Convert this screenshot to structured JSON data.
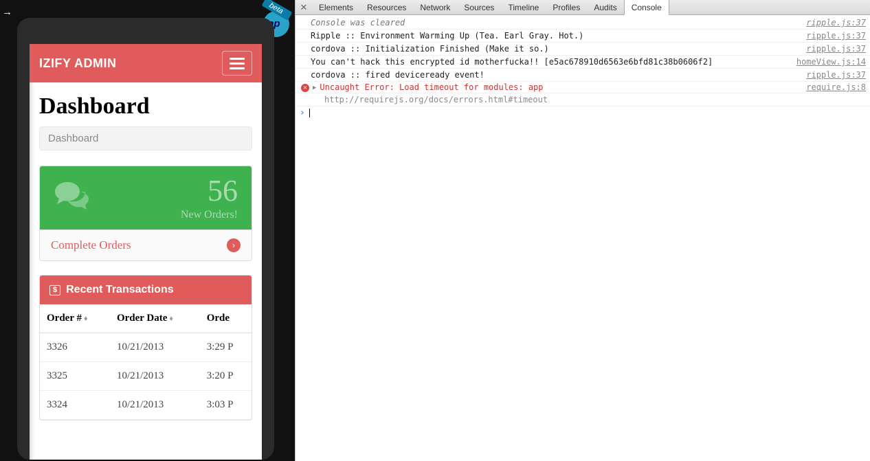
{
  "emulator": {
    "beta_label": "beta",
    "app_name_fragment": "ipp"
  },
  "app": {
    "header_title": "IZIFY ADMIN",
    "page_title": "Dashboard",
    "breadcrumb": "Dashboard",
    "stat": {
      "value": "56",
      "label": "New Orders!",
      "action": "Complete Orders"
    },
    "transactions": {
      "panel_title": "Recent Transactions",
      "columns": [
        "Order #",
        "Order Date",
        "Orde"
      ],
      "rows": [
        {
          "order": "3326",
          "date": "10/21/2013",
          "time": "3:29 P"
        },
        {
          "order": "3325",
          "date": "10/21/2013",
          "time": "3:20 P"
        },
        {
          "order": "3324",
          "date": "10/21/2013",
          "time": "3:03 P"
        }
      ]
    }
  },
  "devtools": {
    "tabs": [
      "Elements",
      "Resources",
      "Network",
      "Sources",
      "Timeline",
      "Profiles",
      "Audits",
      "Console"
    ],
    "active_tab": "Console",
    "logs": [
      {
        "msg": "Console was cleared",
        "src": "ripple.js:37",
        "style": "first"
      },
      {
        "msg": "Ripple :: Environment Warming Up (Tea. Earl Gray. Hot.)",
        "src": "ripple.js:37"
      },
      {
        "msg": "cordova :: Initialization Finished (Make it so.)",
        "src": "ripple.js:37"
      },
      {
        "msg": "You can't hack this encrypted id motherfucka!! [e5ac678910d6563e6bfd81c38b0606f2]",
        "src": "homeView.js:14"
      },
      {
        "msg": "cordova :: fired deviceready event!",
        "src": "ripple.js:37"
      }
    ],
    "error": {
      "msg": "Uncaught Error: Load timeout for modules: app",
      "sub": "http://requirejs.org/docs/errors.html#timeout",
      "src": "require.js:8"
    }
  }
}
